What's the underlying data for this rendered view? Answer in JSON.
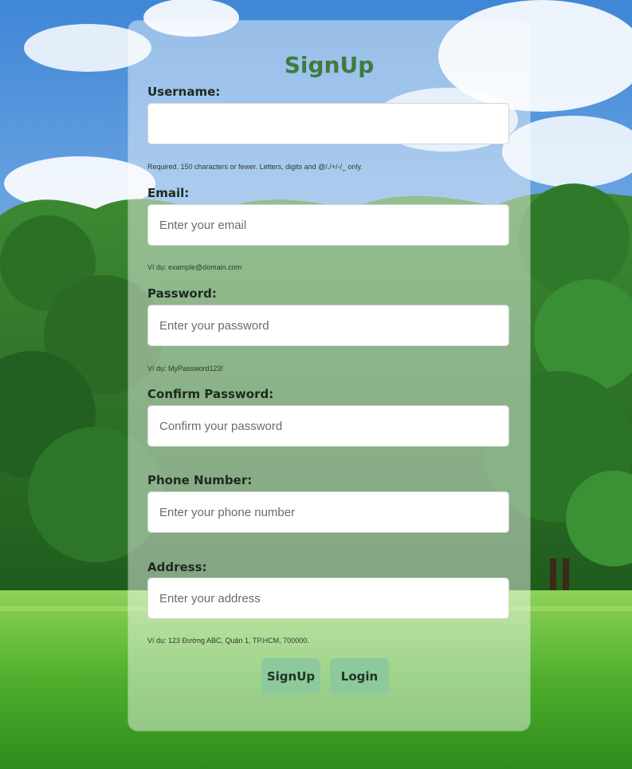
{
  "form": {
    "title": "SignUp",
    "username": {
      "label": "Username:",
      "value": "",
      "placeholder": "",
      "help": "Required. 150 characters or fewer. Letters, digits and @/./+/-/_ only."
    },
    "email": {
      "label": "Email:",
      "placeholder": "Enter your email",
      "help": "Ví dụ: example@domain.com"
    },
    "password": {
      "label": "Password:",
      "placeholder": "Enter your password",
      "help": "Ví dụ: MyPassword123!"
    },
    "confirm_password": {
      "label": "Confirm Password:",
      "placeholder": "Confirm your password"
    },
    "phone": {
      "label": "Phone Number:",
      "placeholder": "Enter your phone number"
    },
    "address": {
      "label": "Address:",
      "placeholder": "Enter your address",
      "help": "Ví dụ: 123 Đường ABC, Quận 1, TP.HCM, 700000."
    },
    "buttons": {
      "signup": "SignUp",
      "login": "Login"
    }
  },
  "colors": {
    "title": "#3f7a3f",
    "button_bg": "#8dc99b",
    "card_bg": "rgba(255,255,255,0.45)"
  }
}
